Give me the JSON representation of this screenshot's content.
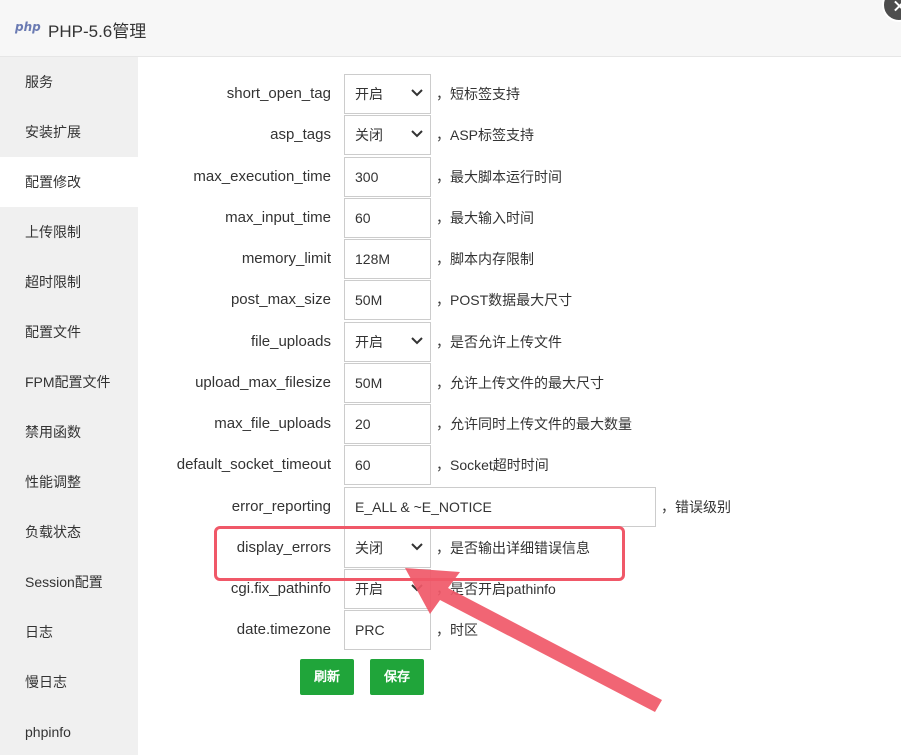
{
  "window": {
    "logo_text": "php",
    "title": "PHP-5.6管理"
  },
  "sidebar": {
    "items": [
      {
        "label": "服务",
        "active": false
      },
      {
        "label": "安装扩展",
        "active": false
      },
      {
        "label": "配置修改",
        "active": true
      },
      {
        "label": "上传限制",
        "active": false
      },
      {
        "label": "超时限制",
        "active": false
      },
      {
        "label": "配置文件",
        "active": false
      },
      {
        "label": "FPM配置文件",
        "active": false
      },
      {
        "label": "禁用函数",
        "active": false
      },
      {
        "label": "性能调整",
        "active": false
      },
      {
        "label": "负载状态",
        "active": false
      },
      {
        "label": "Session配置",
        "active": false
      },
      {
        "label": "日志",
        "active": false
      },
      {
        "label": "慢日志",
        "active": false
      },
      {
        "label": "phpinfo",
        "active": false
      }
    ]
  },
  "settings": [
    {
      "name": "short_open_tag",
      "value": "开启",
      "type": "select",
      "desc": "，短标签支持"
    },
    {
      "name": "asp_tags",
      "value": "关闭",
      "type": "select",
      "desc": "，ASP标签支持"
    },
    {
      "name": "max_execution_time",
      "value": "300",
      "type": "input",
      "desc": "，最大脚本运行时间"
    },
    {
      "name": "max_input_time",
      "value": "60",
      "type": "input",
      "desc": "，最大输入时间"
    },
    {
      "name": "memory_limit",
      "value": "128M",
      "type": "input",
      "desc": "，脚本内存限制"
    },
    {
      "name": "post_max_size",
      "value": "50M",
      "type": "input",
      "desc": "，POST数据最大尺寸"
    },
    {
      "name": "file_uploads",
      "value": "开启",
      "type": "select",
      "desc": "，是否允许上传文件"
    },
    {
      "name": "upload_max_filesize",
      "value": "50M",
      "type": "input",
      "desc": "，允许上传文件的最大尺寸"
    },
    {
      "name": "max_file_uploads",
      "value": "20",
      "type": "input",
      "desc": "，允许同时上传文件的最大数量"
    },
    {
      "name": "default_socket_timeout",
      "value": "60",
      "type": "input",
      "desc": "，Socket超时时间"
    },
    {
      "name": "error_reporting",
      "value": "E_ALL & ~E_NOTICE",
      "type": "input-wide",
      "desc": "，错误级别"
    },
    {
      "name": "display_errors",
      "value": "关闭",
      "type": "select",
      "desc": "，是否输出详细错误信息"
    },
    {
      "name": "cgi.fix_pathinfo",
      "value": "开启",
      "type": "select",
      "desc": "，是否开启pathinfo"
    },
    {
      "name": "date.timezone",
      "value": "PRC",
      "type": "input",
      "desc": "，时区"
    }
  ],
  "buttons": {
    "refresh": "刷新",
    "save": "保存"
  },
  "colors": {
    "accent_green": "#20a53a",
    "annotation_red": "#f05868",
    "sidebar_bg": "#f0f0f0"
  }
}
